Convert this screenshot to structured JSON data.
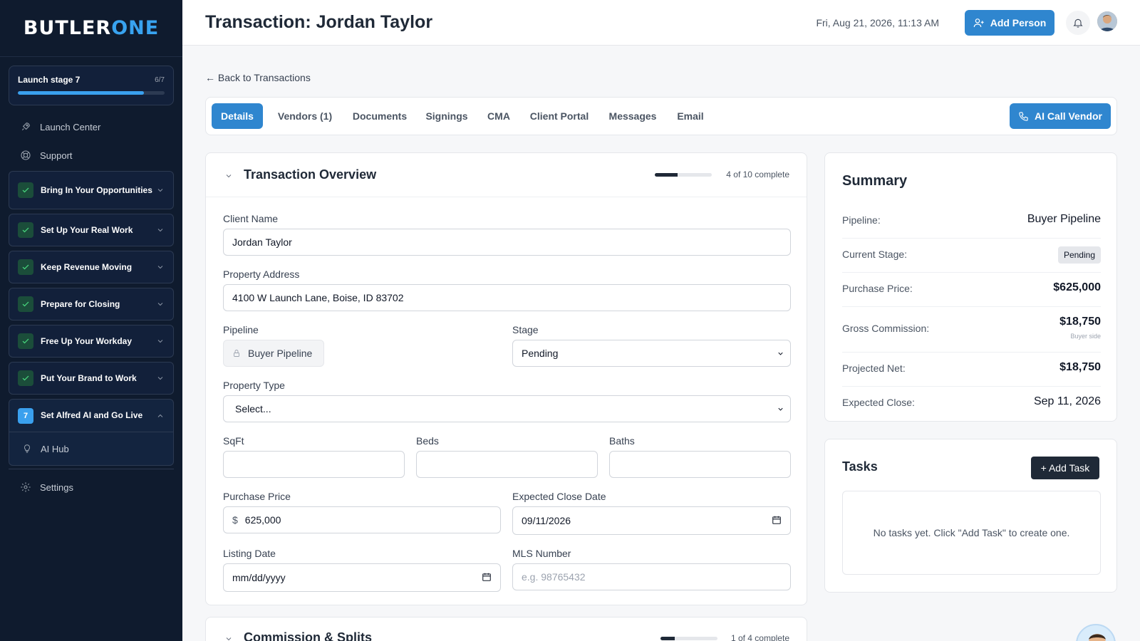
{
  "sidebar": {
    "logo_part1": "BUTLER",
    "logo_part2": "ONE",
    "launch": {
      "title": "Launch stage 7",
      "count": "6/7",
      "progress": 0.857
    },
    "links": [
      {
        "label": "Launch Center",
        "icon": "rocket-icon"
      },
      {
        "label": "Support",
        "icon": "lifebuoy-icon"
      }
    ],
    "groups": [
      {
        "label": "Bring In Your Opportunities",
        "done": true
      },
      {
        "label": "Set Up Your Real Work",
        "done": true
      },
      {
        "label": "Keep Revenue Moving",
        "done": true
      },
      {
        "label": "Prepare for Closing",
        "done": true
      },
      {
        "label": "Free Up Your Workday",
        "done": true
      },
      {
        "label": "Put Your Brand to Work",
        "done": true
      },
      {
        "label": "Set Alfred AI and Go Live",
        "done": false,
        "number": "7",
        "open": true,
        "sub": "AI Hub"
      }
    ],
    "settings": "Settings"
  },
  "header": {
    "title": "Transaction: Jordan Taylor",
    "datetime": "Fri, Aug 21, 2026, 11:13 AM",
    "add_person": "Add Person"
  },
  "back_link": "← Back to Transactions",
  "tabs": [
    "Details",
    "Vendors (1)",
    "Documents",
    "Signings",
    "CMA",
    "Client Portal",
    "Messages",
    "Email"
  ],
  "active_tab": "Details",
  "ai_call_vendor": "AI Call Vendor",
  "overview": {
    "title": "Transaction Overview",
    "progress_text": "4 of 10 complete",
    "progress": 0.4,
    "fields": {
      "client_name_label": "Client Name",
      "client_name": "Jordan Taylor",
      "address_label": "Property Address",
      "address": "4100 W Launch Lane, Boise, ID 83702",
      "pipeline_label": "Pipeline",
      "pipeline": "Buyer Pipeline",
      "stage_label": "Stage",
      "stage": "Pending",
      "property_type_label": "Property Type",
      "property_type": "Select...",
      "sqft_label": "SqFt",
      "beds_label": "Beds",
      "baths_label": "Baths",
      "purchase_price_label": "Purchase Price",
      "currency": "$",
      "purchase_price": "625,000",
      "close_date_label": "Expected Close Date",
      "close_date": "09/11/2026",
      "listing_date_label": "Listing Date",
      "listing_date": "mm/dd/yyyy",
      "mls_label": "MLS Number",
      "mls_placeholder": "e.g. 98765432"
    }
  },
  "commission": {
    "title": "Commission & Splits",
    "progress_text": "1 of 4 complete",
    "progress": 0.25
  },
  "summary": {
    "title": "Summary",
    "pipeline_label": "Pipeline:",
    "pipeline": "Buyer Pipeline",
    "stage_label": "Current Stage:",
    "stage": "Pending",
    "price_label": "Purchase Price:",
    "price": "$625,000",
    "commission_label": "Gross Commission:",
    "commission": "$18,750",
    "commission_note": "Buyer side",
    "net_label": "Projected Net:",
    "net": "$18,750",
    "close_label": "Expected Close:",
    "close": "Sep 11, 2026"
  },
  "tasks": {
    "title": "Tasks",
    "add_label": "+ Add Task",
    "empty": "No tasks yet. Click \"Add Task\" to create one."
  }
}
